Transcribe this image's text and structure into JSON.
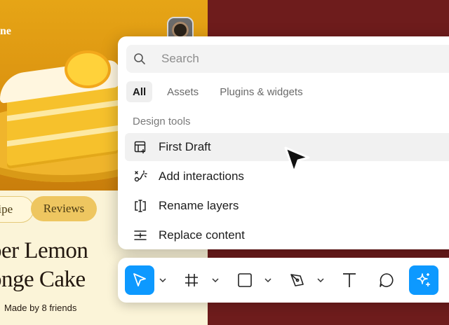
{
  "recipe_card": {
    "hero_text": "ne",
    "tabs": [
      "cipe",
      "Reviews"
    ],
    "title_line1": "per Lemon",
    "title_line2": "onge Cake",
    "made_by": "Made by 8 friends"
  },
  "search": {
    "placeholder": "Search"
  },
  "filters": [
    "All",
    "Assets",
    "Plugins & widgets"
  ],
  "section": {
    "label": "Design tools",
    "items": [
      {
        "label": "First Draft",
        "icon": "first-draft-icon"
      },
      {
        "label": "Add interactions",
        "icon": "interactions-icon"
      },
      {
        "label": "Rename layers",
        "icon": "rename-layers-icon"
      },
      {
        "label": "Replace content",
        "icon": "replace-content-icon"
      }
    ]
  },
  "toolbar": {
    "tools": [
      "move-tool",
      "frame-tool",
      "shape-tool",
      "pen-tool",
      "text-tool",
      "comment-tool",
      "ai-tool"
    ]
  },
  "colors": {
    "accent": "#0d99ff",
    "background": "#6e1c1c",
    "card": "#fbf4d8"
  }
}
